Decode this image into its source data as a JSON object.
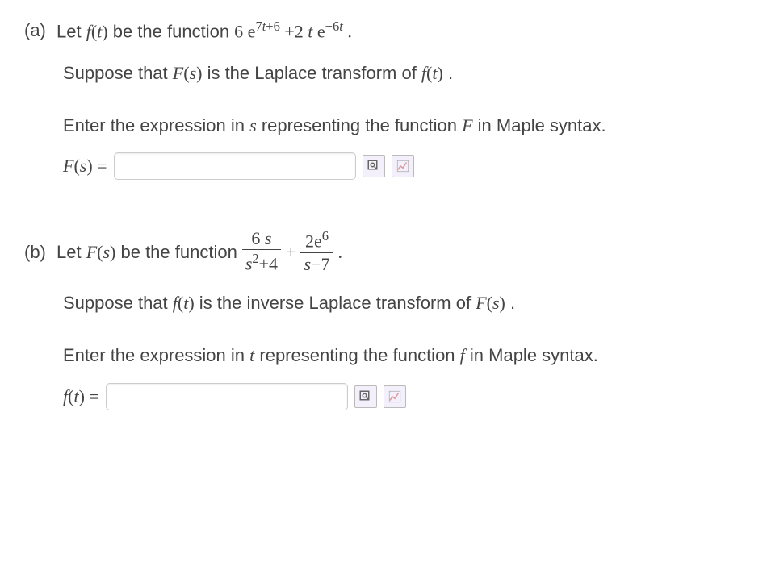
{
  "partA": {
    "label": "(a)",
    "let_prefix": "Let ",
    "func1_f": "f",
    "func1_paren_open": "(",
    "func1_t": "t",
    "func1_paren_close": ")",
    "be_the_function": "  be the function  ",
    "expr_coef1": "6 e",
    "expr_exp1a": "7",
    "expr_exp1b": "t",
    "expr_exp1c": "+6",
    "expr_mid": " +2 ",
    "expr_t": "t ",
    "expr_e2": "e",
    "expr_exp2a": "−6",
    "expr_exp2b": "t",
    "expr_period": " .",
    "suppose_prefix": "Suppose that  ",
    "cap_F": "F",
    "paren_open": "(",
    "var_s": "s",
    "paren_close": ")",
    "is_laplace": " is the Laplace transform of  ",
    "low_f": "f",
    "var_t": "t",
    "period2": " .",
    "enter_prefix": "Enter the expression in ",
    "enter_var": "s",
    "enter_suffix": " representing the function ",
    "enter_F": "F",
    "enter_end": " in Maple syntax.",
    "answer_F": "F",
    "answer_paren_open": "(",
    "answer_s": "s",
    "answer_paren_close": ") ",
    "answer_eq": "="
  },
  "partB": {
    "label": "(b)",
    "let_prefix": "Let  ",
    "cap_F": "F",
    "paren_open": "(",
    "var_s": "s",
    "paren_close": ")",
    "be_the_function": " be the function   ",
    "frac1_num_a": "6 ",
    "frac1_num_b": "s",
    "frac1_den_a": "s",
    "frac1_den_b": "2",
    "frac1_den_c": "+4",
    "plus": " + ",
    "frac2_num_a": "2e",
    "frac2_num_b": "6",
    "frac2_den_a": "s",
    "frac2_den_b": "−7",
    "expr_period": " .",
    "suppose_prefix": "Suppose that  ",
    "low_f": "f",
    "paren_open2": "(",
    "var_t": "t",
    "paren_close2": ")",
    "is_inverse": " is the inverse Laplace transform of ",
    "cap_F2": "F",
    "var_s2": "s",
    "period2": " .",
    "enter_prefix": "Enter the expression in ",
    "enter_var": "t",
    "enter_suffix": " representing the function ",
    "enter_f": "f",
    "enter_end": " in Maple syntax.",
    "answer_f": "f",
    "answer_paren_open": "(",
    "answer_t": "t",
    "answer_paren_close": ") ",
    "answer_eq": "="
  }
}
